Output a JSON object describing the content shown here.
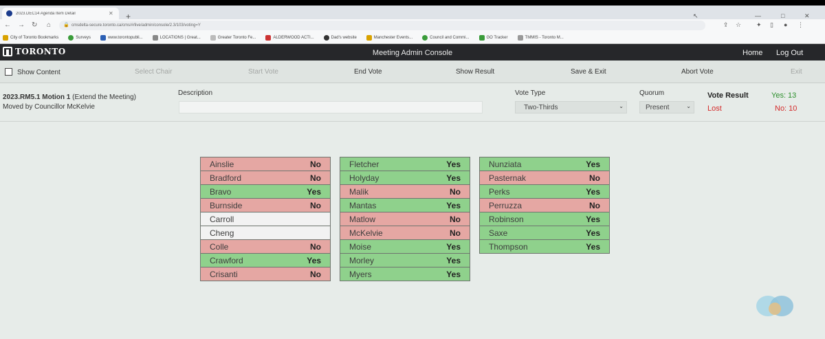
{
  "browser": {
    "tab_title": "2023.DEC14 Agenda Item Detail",
    "url": "cmsdelta-secure.toronto.ca/cms/#/live/admin/console/2.3/103/voting=Y",
    "bookmarks": [
      "City of Toronto Bookmarks",
      "Surveys",
      "www.torontopubli...",
      "LOCATIONS | Great...",
      "Greater Toronto Fe...",
      "ALDERWOOD ACTI...",
      "Dad's website",
      "Manchester Events...",
      "Council and Commi...",
      "GO Tracker",
      "TMMIS - Toronto M..."
    ]
  },
  "app": {
    "logo_text": "TORONTO",
    "title": "Meeting Admin Console",
    "nav": {
      "home": "Home",
      "logout": "Log Out"
    }
  },
  "toolbar": {
    "show_content": "Show Content",
    "select_chair": "Select Chair",
    "start_vote": "Start Vote",
    "end_vote": "End Vote",
    "show_result": "Show Result",
    "save_exit": "Save & Exit",
    "abort_vote": "Abort Vote",
    "exit": "Exit"
  },
  "motion": {
    "id": "2023.RM5.1 Motion 1",
    "subtitle": "(Extend the Meeting)",
    "moved_by": "Moved by Councillor McKelvie",
    "description_label": "Description",
    "description_value": "",
    "vote_type_label": "Vote Type",
    "vote_type_value": "Two-Thirds",
    "quorum_label": "Quorum",
    "quorum_value": "Present",
    "vote_result_label": "Vote Result",
    "vote_result_outcome": "Lost",
    "yes_count": "Yes: 13",
    "no_count": "No: 10"
  },
  "colors": {
    "yes": "#8fd18c",
    "no": "#e5a7a3",
    "absent": "#f2f2f2",
    "header": "#26272a"
  },
  "votes": [
    [
      {
        "name": "Ainslie",
        "vote": "No"
      },
      {
        "name": "Bradford",
        "vote": "No"
      },
      {
        "name": "Bravo",
        "vote": "Yes"
      },
      {
        "name": "Burnside",
        "vote": "No"
      },
      {
        "name": "Carroll",
        "vote": ""
      },
      {
        "name": "Cheng",
        "vote": ""
      },
      {
        "name": "Colle",
        "vote": "No"
      },
      {
        "name": "Crawford",
        "vote": "Yes"
      },
      {
        "name": "Crisanti",
        "vote": "No"
      }
    ],
    [
      {
        "name": "Fletcher",
        "vote": "Yes"
      },
      {
        "name": "Holyday",
        "vote": "Yes"
      },
      {
        "name": "Malik",
        "vote": "No"
      },
      {
        "name": "Mantas",
        "vote": "Yes"
      },
      {
        "name": "Matlow",
        "vote": "No"
      },
      {
        "name": "McKelvie",
        "vote": "No"
      },
      {
        "name": "Moise",
        "vote": "Yes"
      },
      {
        "name": "Morley",
        "vote": "Yes"
      },
      {
        "name": "Myers",
        "vote": "Yes"
      }
    ],
    [
      {
        "name": "Nunziata",
        "vote": "Yes"
      },
      {
        "name": "Pasternak",
        "vote": "No"
      },
      {
        "name": "Perks",
        "vote": "Yes"
      },
      {
        "name": "Perruzza",
        "vote": "No"
      },
      {
        "name": "Robinson",
        "vote": "Yes"
      },
      {
        "name": "Saxe",
        "vote": "Yes"
      },
      {
        "name": "Thompson",
        "vote": "Yes"
      }
    ]
  ]
}
